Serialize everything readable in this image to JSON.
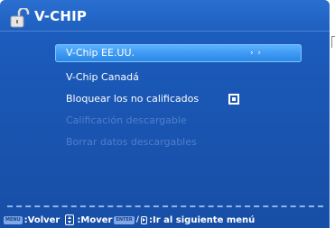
{
  "header": {
    "title": "V-CHIP",
    "icon": "padlock-icon"
  },
  "menu": {
    "items": [
      {
        "label": "V-Chip EE.UU.",
        "state": "selected",
        "indicator": "› ›"
      },
      {
        "label": "V-Chip Canadá",
        "state": "enabled"
      },
      {
        "label": "Bloquear los no calificados",
        "state": "enabled",
        "checkbox": true
      },
      {
        "label": "Calificación descargable",
        "state": "disabled"
      },
      {
        "label": "Borrar datos descargables",
        "state": "disabled"
      }
    ]
  },
  "footer": {
    "menu_key": "MENU",
    "back_label": ":Volver",
    "move_label": ":Mover",
    "enter_key": "ENTER",
    "next_label": ":Ir al siguiente menú"
  },
  "colors": {
    "panel": "#1a56b3",
    "highlight": "#3c98f2",
    "disabled_text": "#4f7fca",
    "text": "#ffffff"
  }
}
